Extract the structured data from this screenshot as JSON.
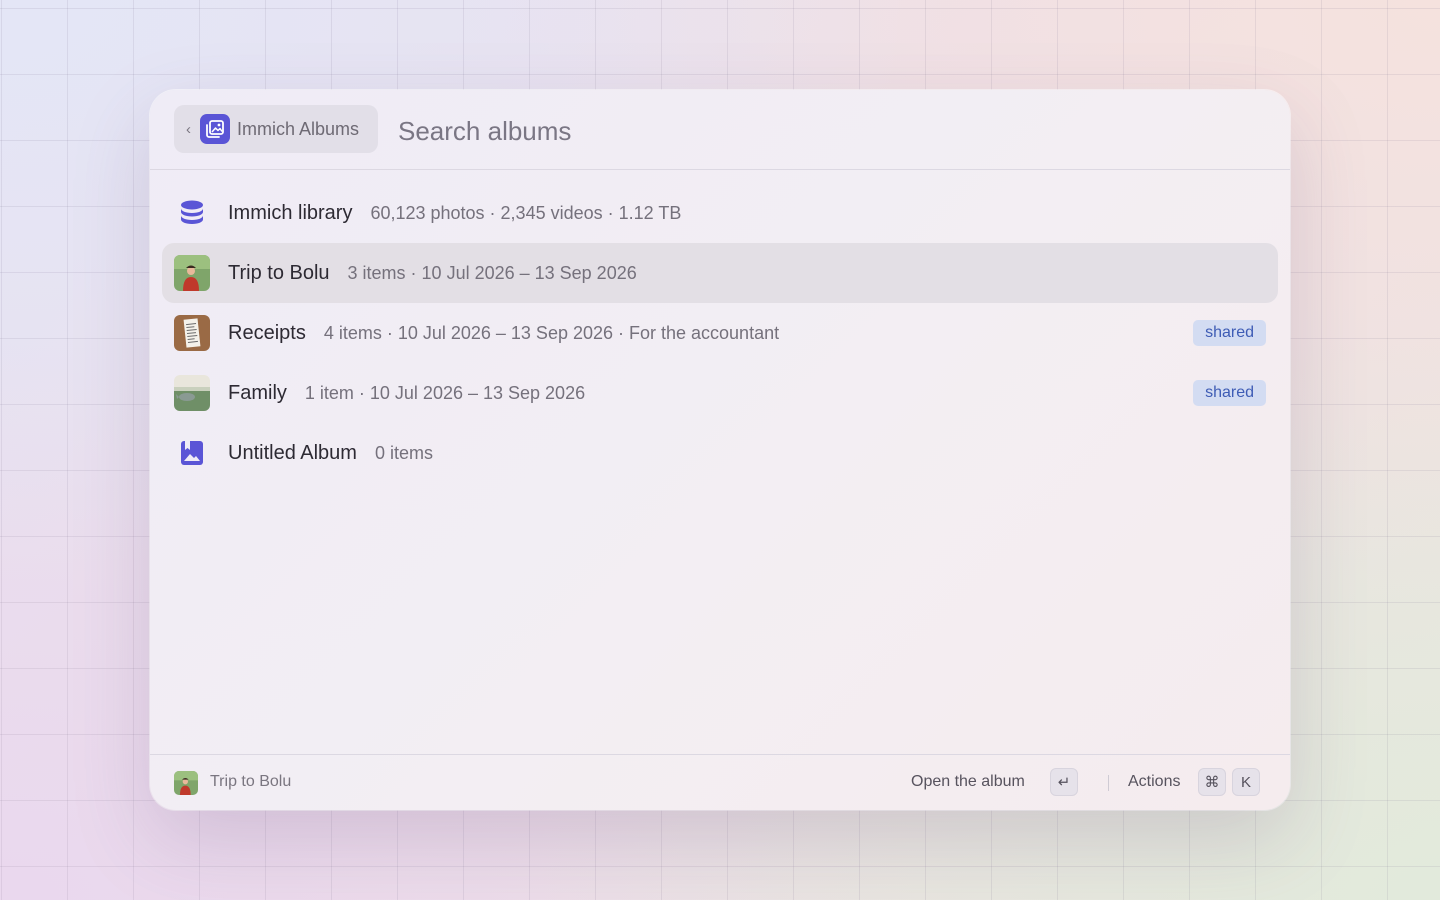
{
  "colors": {
    "accent": "#5a55d6",
    "badge_bg": "#d3dcf2",
    "badge_text": "#3e5cb5",
    "selected_row": "#e3dfe5"
  },
  "header": {
    "back_icon": "chevron-left-icon",
    "extension_icon": "photo-album-icon",
    "extension_name": "Immich Albums",
    "search_placeholder": "Search albums",
    "search_value": ""
  },
  "items": [
    {
      "icon": "database-icon",
      "title": "Immich library",
      "subtitle": "60,123 photos · 2,345 videos · 1.12 TB",
      "badge": null,
      "selected": false
    },
    {
      "icon": "trip-thumbnail",
      "title": "Trip to Bolu",
      "subtitle": "3 items · 10 Jul 2026 – 13 Sep 2026",
      "badge": null,
      "selected": true
    },
    {
      "icon": "receipt-thumbnail",
      "title": "Receipts",
      "subtitle": "4 items · 10 Jul 2026 – 13 Sep 2026 · For the accountant",
      "badge": "shared",
      "selected": false
    },
    {
      "icon": "family-thumbnail",
      "title": "Family",
      "subtitle": "1 item · 10 Jul 2026 – 13 Sep 2026",
      "badge": "shared",
      "selected": false
    },
    {
      "icon": "album-bookmark-icon",
      "title": "Untitled Album",
      "subtitle": "0 items",
      "badge": null,
      "selected": false
    }
  ],
  "footer": {
    "selected_label": "Trip to Bolu",
    "primary_action": "Open the album",
    "primary_key": "↵",
    "actions_label": "Actions",
    "actions_keys": [
      "⌘",
      "K"
    ]
  }
}
